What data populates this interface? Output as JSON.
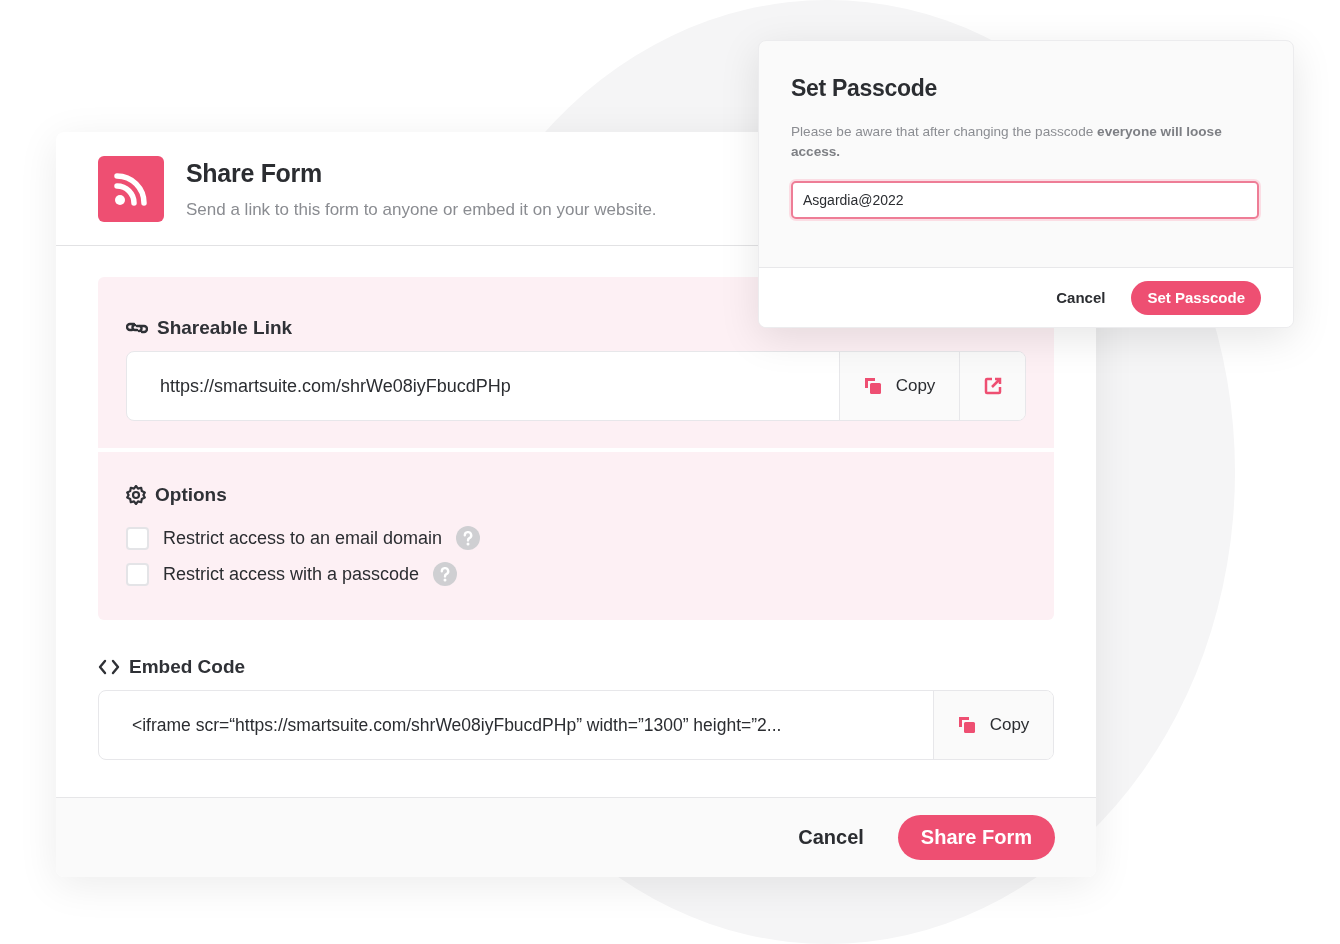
{
  "share_dialog": {
    "title": "Share Form",
    "subtitle": "Send a link to this form to anyone or embed it on your website.",
    "shareable_link": {
      "label": "Shareable Link",
      "url": "https://smartsuite.com/shrWe08iyFbucdPHp",
      "copy_button": "Copy"
    },
    "options": {
      "label": "Options",
      "items": [
        {
          "label": "Restrict access to an email domain",
          "checked": false
        },
        {
          "label": "Restrict access with a passcode",
          "checked": false
        }
      ]
    },
    "embed_code": {
      "label": "Embed Code",
      "code": "<iframe scr=“https://smartsuite.com/shrWe08iyFbucdPHp” width=”1300” height=”2...",
      "copy_button": "Copy"
    },
    "buttons": [
      {
        "label": "Cancel",
        "kind": "secondary"
      },
      {
        "label": "Share Form",
        "kind": "primary"
      }
    ]
  },
  "passcode_dialog": {
    "title": "Set Passcode",
    "message": "Please be aware that after changing the passcode **everyone will loose access.**",
    "value": "Asgardia@2022",
    "buttons": [
      {
        "label": "Cancel",
        "kind": "secondary"
      },
      {
        "label": "Set Passcode",
        "kind": "primary"
      }
    ]
  }
}
